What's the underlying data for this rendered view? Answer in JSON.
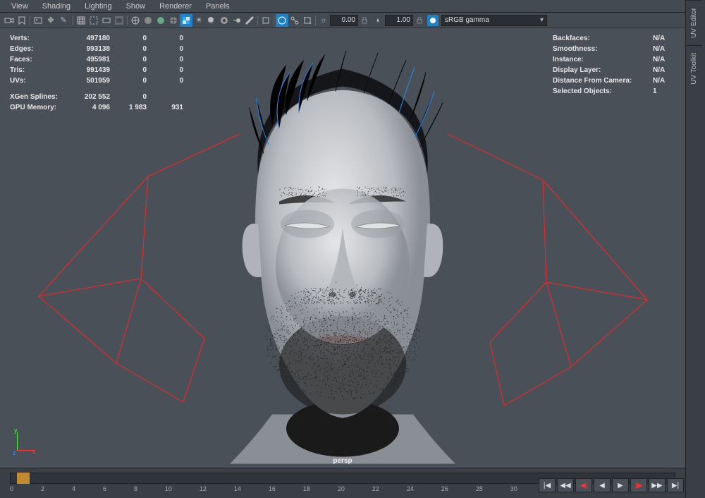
{
  "menu": [
    "View",
    "Shading",
    "Lighting",
    "Show",
    "Renderer",
    "Panels"
  ],
  "toolbar": {
    "num1": "0.00",
    "num2": "1.00",
    "colorProfile": "sRGB gamma"
  },
  "hudLeft": {
    "rows": [
      {
        "label": "Verts:",
        "c1": "497180",
        "c2": "0",
        "c3": "0"
      },
      {
        "label": "Edges:",
        "c1": "993138",
        "c2": "0",
        "c3": "0"
      },
      {
        "label": "Faces:",
        "c1": "495981",
        "c2": "0",
        "c3": "0"
      },
      {
        "label": "Tris:",
        "c1": "991439",
        "c2": "0",
        "c3": "0"
      },
      {
        "label": "UVs:",
        "c1": "501959",
        "c2": "0",
        "c3": "0"
      }
    ],
    "rows2": [
      {
        "label": "XGen Splines:",
        "c1": "202 552",
        "c2": "0",
        "c3": ""
      },
      {
        "label": "GPU Memory:",
        "c1": "4 096",
        "c2": "1 983",
        "c3": "931"
      }
    ]
  },
  "hudRight": [
    {
      "label": "Backfaces:",
      "val": "N/A"
    },
    {
      "label": "Smoothness:",
      "val": "N/A"
    },
    {
      "label": "Instance:",
      "val": "N/A"
    },
    {
      "label": "Display Layer:",
      "val": "N/A"
    },
    {
      "label": "Distance From Camera:",
      "val": "N/A"
    },
    {
      "label": "Selected Objects:",
      "val": "1"
    }
  ],
  "axis": {
    "y": "y",
    "x": "x",
    "z": "z"
  },
  "camera": "persp",
  "timeline": {
    "ticks": [
      "0",
      "2",
      "4",
      "6",
      "8",
      "10",
      "12",
      "14",
      "16",
      "18",
      "20",
      "22",
      "24",
      "26",
      "28",
      "30"
    ]
  },
  "rightTabs": [
    "UV Editor",
    "UV Toolkit"
  ]
}
